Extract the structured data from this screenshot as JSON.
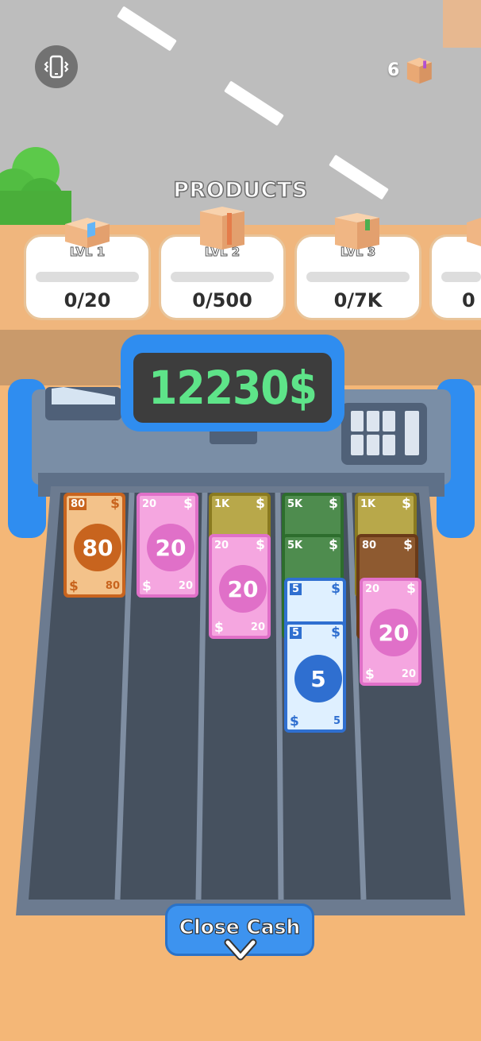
{
  "header": {
    "products_title": "PRODUCTS",
    "box_count": "6",
    "vibrate_icon": "phone-vibrate-icon",
    "box_icon": "cardboard-box-icon"
  },
  "products": [
    {
      "label": "LVL 1",
      "value": "0/20",
      "progress": 0,
      "box_tape": "#64b5f6"
    },
    {
      "label": "LVL 2",
      "value": "0/500",
      "progress": 0,
      "box_tape": "#e57c4a"
    },
    {
      "label": "LVL 3",
      "value": "0/7K",
      "progress": 0,
      "box_tape": "#4caf50"
    },
    {
      "label": "",
      "value": "0",
      "progress": 0,
      "box_tape": "#d9d9d9"
    }
  ],
  "register": {
    "cash_display": "12230$"
  },
  "bills": [
    {
      "column": 1,
      "denomination": "80",
      "corner": "80",
      "color": "#c8641e",
      "face": "#f3c28a"
    },
    {
      "column": 2,
      "denomination": "20",
      "corner": "20",
      "color": "#e070c8",
      "face": "#f5a6e0"
    },
    {
      "column": 3,
      "denomination": "1K",
      "corner": "1K",
      "color": "#8a7a20",
      "face": "#b8a84a"
    },
    {
      "column": 3,
      "denomination": "20",
      "corner": "20",
      "color": "#e070c8",
      "face": "#f5a6e0"
    },
    {
      "column": 4,
      "denomination": "5K",
      "corner": "5K",
      "color": "#2d6d2d",
      "face": "#4e8c4e"
    },
    {
      "column": 4,
      "denomination": "5K",
      "corner": "5K",
      "color": "#2d6d2d",
      "face": "#4e8c4e"
    },
    {
      "column": 4,
      "denomination": "5",
      "corner": "5",
      "color": "#2f6fd0",
      "face": "#dff0ff"
    },
    {
      "column": 4,
      "denomination": "5",
      "corner": "5",
      "color": "#2f6fd0",
      "face": "#dff0ff"
    },
    {
      "column": 5,
      "denomination": "1K",
      "corner": "1K",
      "color": "#8a7a20",
      "face": "#b8a84a"
    },
    {
      "column": 5,
      "denomination": "80",
      "corner": "80",
      "color": "#6a3a18",
      "face": "#8e5a30"
    },
    {
      "column": 5,
      "denomination": "20",
      "corner": "20",
      "color": "#e070c8",
      "face": "#f5a6e0"
    }
  ],
  "actions": {
    "close_cash_label": "Close Cash",
    "chevron_icon": "chevron-down-icon"
  },
  "colors": {
    "sand": "#f4b777",
    "register_blue": "#2f8df0",
    "display_green": "#5ee489"
  }
}
